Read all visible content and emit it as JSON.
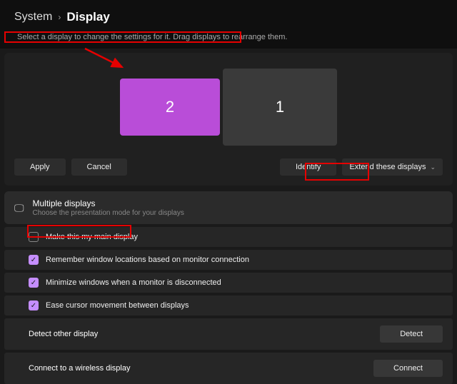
{
  "breadcrumb": {
    "parent": "System",
    "current": "Display"
  },
  "instruction": "Select a display to change the settings for it. Drag displays to rearrange them.",
  "displays": {
    "active": "2",
    "other": "1"
  },
  "buttons": {
    "apply": "Apply",
    "cancel": "Cancel",
    "identify": "Identify"
  },
  "extend": "Extend these displays",
  "section": {
    "title": "Multiple displays",
    "subtitle": "Choose the presentation mode for your displays"
  },
  "opts": {
    "main": "Make this my main display",
    "remember": "Remember window locations based on monitor connection",
    "minimize": "Minimize windows when a monitor is disconnected",
    "cursor": "Ease cursor movement between displays"
  },
  "detect": {
    "label": "Detect other display",
    "btn": "Detect"
  },
  "wireless": {
    "label": "Connect to a wireless display",
    "btn": "Connect"
  }
}
